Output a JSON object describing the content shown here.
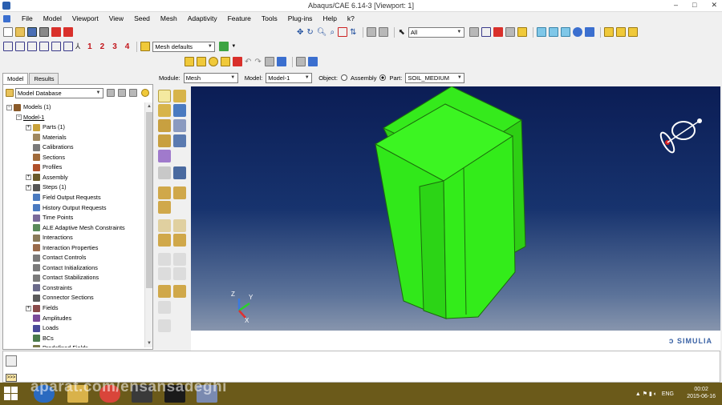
{
  "window": {
    "title": "Abaqus/CAE 6.14-3 [Viewport: 1]",
    "min": "–",
    "max": "□",
    "close": "✕"
  },
  "menu": [
    "File",
    "Model",
    "Viewport",
    "View",
    "Seed",
    "Mesh",
    "Adaptivity",
    "Feature",
    "Tools",
    "Plug-ins",
    "Help",
    "k?"
  ],
  "toolbar2": {
    "nums": [
      "1",
      "2",
      "3",
      "4"
    ],
    "mesh_defaults": "Mesh defaults"
  },
  "toolbar1": {
    "selection_filter": "All"
  },
  "tabs": [
    "Model",
    "Results"
  ],
  "model_db": "Model Database",
  "tree": [
    {
      "label": "Models (1)",
      "indent": 0,
      "expander": "−",
      "icon": "#8a5a2a"
    },
    {
      "label": "Model-1",
      "indent": 1,
      "expander": "−",
      "icon": null,
      "underline": true
    },
    {
      "label": "Parts (1)",
      "indent": 2,
      "expander": "+",
      "icon": "#c9a23a"
    },
    {
      "label": "Materials",
      "indent": 2,
      "expander": null,
      "icon": "#a08860"
    },
    {
      "label": "Calibrations",
      "indent": 2,
      "expander": null,
      "icon": "#7a7a7a"
    },
    {
      "label": "Sections",
      "indent": 2,
      "expander": null,
      "icon": "#a06a3a"
    },
    {
      "label": "Profiles",
      "indent": 2,
      "expander": null,
      "icon": "#b0502a"
    },
    {
      "label": "Assembly",
      "indent": 2,
      "expander": "+",
      "icon": "#6a5a2a"
    },
    {
      "label": "Steps (1)",
      "indent": 2,
      "expander": "+",
      "icon": "#555"
    },
    {
      "label": "Field Output Requests",
      "indent": 2,
      "expander": null,
      "icon": "#4a7ac0"
    },
    {
      "label": "History Output Requests",
      "indent": 2,
      "expander": null,
      "icon": "#4a7ac0"
    },
    {
      "label": "Time Points",
      "indent": 2,
      "expander": null,
      "icon": "#7a6a9a"
    },
    {
      "label": "ALE Adaptive Mesh Constraints",
      "indent": 2,
      "expander": null,
      "icon": "#5a8a5a"
    },
    {
      "label": "Interactions",
      "indent": 2,
      "expander": null,
      "icon": "#8a7a5a"
    },
    {
      "label": "Interaction Properties",
      "indent": 2,
      "expander": null,
      "icon": "#9a6a4a"
    },
    {
      "label": "Contact Controls",
      "indent": 2,
      "expander": null,
      "icon": "#7a7a7a"
    },
    {
      "label": "Contact Initializations",
      "indent": 2,
      "expander": null,
      "icon": "#7a7a7a"
    },
    {
      "label": "Contact Stabilizations",
      "indent": 2,
      "expander": null,
      "icon": "#7a7a7a"
    },
    {
      "label": "Constraints",
      "indent": 2,
      "expander": null,
      "icon": "#6a6a8a"
    },
    {
      "label": "Connector Sections",
      "indent": 2,
      "expander": null,
      "icon": "#5a5a5a"
    },
    {
      "label": "Fields",
      "indent": 2,
      "expander": "+",
      "icon": "#8a4a4a"
    },
    {
      "label": "Amplitudes",
      "indent": 2,
      "expander": null,
      "icon": "#7a4a9a"
    },
    {
      "label": "Loads",
      "indent": 2,
      "expander": null,
      "icon": "#4a4a9a"
    },
    {
      "label": "BCs",
      "indent": 2,
      "expander": null,
      "icon": "#4a7a4a"
    },
    {
      "label": "Predefined Fields",
      "indent": 2,
      "expander": null,
      "icon": "#7a7a4a"
    }
  ],
  "context": {
    "module_label": "Module:",
    "module": "Mesh",
    "model_label": "Model:",
    "model": "Model-1",
    "object_label": "Object:",
    "assembly": "Assembly",
    "part_label": "Part:",
    "part": "SOIL_MEDIUM"
  },
  "triad": {
    "z": "Z",
    "y": "Y",
    "x": "X"
  },
  "brand": "SIMULIA",
  "watermark": "aparat.com/ensansadeghi",
  "cmd_prompt": ">>>",
  "taskbar": {
    "lang": "ENG",
    "time": "00:02",
    "date": "2015-06-16"
  },
  "colors": {
    "part": "#33ff1a",
    "part_edge": "#1f8a0f",
    "viewport_top": "#0b1d55"
  }
}
